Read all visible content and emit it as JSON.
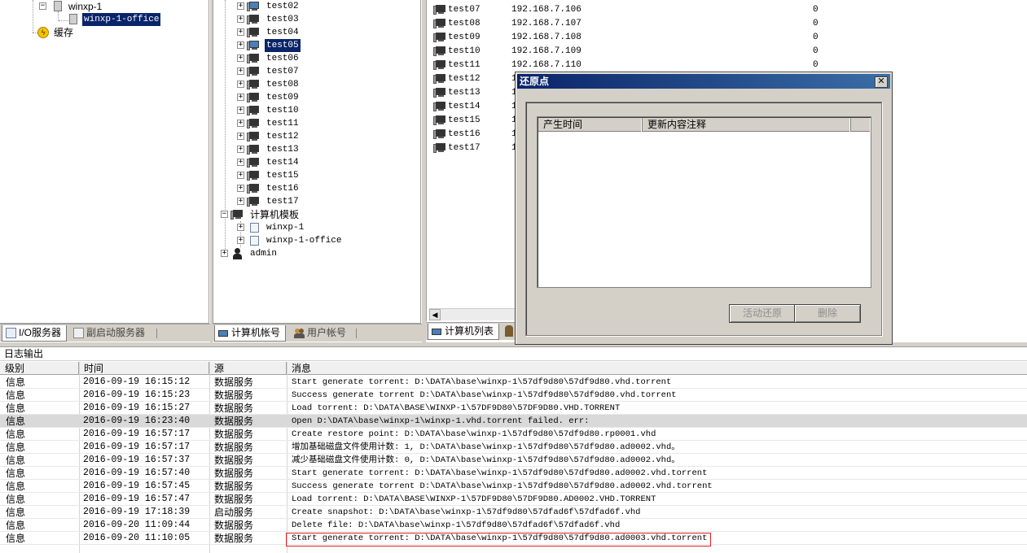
{
  "left_tree": {
    "items": [
      {
        "label": "winxp-1"
      },
      {
        "label": "winxp-1-office"
      },
      {
        "label": "缓存"
      }
    ]
  },
  "left_tabs": [
    "I/O服务器",
    "副启动服务器"
  ],
  "mid_tree": {
    "computers": [
      "test02",
      "test03",
      "test04",
      "test05",
      "test06",
      "test07",
      "test08",
      "test09",
      "test10",
      "test11",
      "test12",
      "test13",
      "test14",
      "test15",
      "test16",
      "test17"
    ],
    "selected": "test05",
    "templates_label": "计算机模板",
    "templates": [
      "winxp-1",
      "winxp-1-office"
    ],
    "user": "admin"
  },
  "mid_tabs": [
    "计算机帐号",
    "用户帐号"
  ],
  "right_list": {
    "rows": [
      {
        "name": "test07",
        "ip": "192.168.7.106",
        "val": "0"
      },
      {
        "name": "test08",
        "ip": "192.168.7.107",
        "val": "0"
      },
      {
        "name": "test09",
        "ip": "192.168.7.108",
        "val": "0"
      },
      {
        "name": "test10",
        "ip": "192.168.7.109",
        "val": "0"
      },
      {
        "name": "test11",
        "ip": "192.168.7.110",
        "val": "0"
      },
      {
        "name": "test12",
        "ip": "1",
        "val": ""
      },
      {
        "name": "test13",
        "ip": "1",
        "val": ""
      },
      {
        "name": "test14",
        "ip": "1",
        "val": ""
      },
      {
        "name": "test15",
        "ip": "1",
        "val": ""
      },
      {
        "name": "test16",
        "ip": "1",
        "val": ""
      },
      {
        "name": "test17",
        "ip": "1",
        "val": ""
      }
    ]
  },
  "right_tabs": [
    "计算机列表"
  ],
  "dialog": {
    "title": "还原点",
    "close": "✕",
    "columns": [
      "产生时间",
      "更新内容注释"
    ],
    "buttons": {
      "restore": "活动还原",
      "delete": "删除"
    }
  },
  "log": {
    "title": "日志输出",
    "columns": [
      "级别",
      "时间",
      "源",
      "消息"
    ],
    "rows": [
      {
        "level": "信息",
        "time": "2016-09-19 16:15:12",
        "source": "数据服务",
        "msg": "Start generate torrent: D:\\DATA\\base\\winxp-1\\57df9d80\\57df9d80.vhd.torrent"
      },
      {
        "level": "信息",
        "time": "2016-09-19 16:15:23",
        "source": "数据服务",
        "msg": "Success generate torrent D:\\DATA\\base\\winxp-1\\57df9d80\\57df9d80.vhd.torrent"
      },
      {
        "level": "信息",
        "time": "2016-09-19 16:15:27",
        "source": "数据服务",
        "msg": "Load torrent: D:\\DATA\\BASE\\WINXP-1\\57DF9D80\\57DF9D80.VHD.TORRENT"
      },
      {
        "level": "信息",
        "time": "2016-09-19 16:23:40",
        "source": "数据服务",
        "msg": "Open D:\\DATA\\base\\winxp-1\\winxp-1.vhd.torrent failed. err:"
      },
      {
        "level": "信息",
        "time": "2016-09-19 16:57:17",
        "source": "数据服务",
        "msg": "Create restore point: D:\\DATA\\base\\winxp-1\\57df9d80\\57df9d80.rp0001.vhd"
      },
      {
        "level": "信息",
        "time": "2016-09-19 16:57:17",
        "source": "数据服务",
        "msg": "增加基础磁盘文件使用计数: 1, D:\\DATA\\base\\winxp-1\\57df9d80\\57df9d80.ad0002.vhd。"
      },
      {
        "level": "信息",
        "time": "2016-09-19 16:57:37",
        "source": "数据服务",
        "msg": "减少基础磁盘文件使用计数: 0, D:\\DATA\\base\\winxp-1\\57df9d80\\57df9d80.ad0002.vhd。"
      },
      {
        "level": "信息",
        "time": "2016-09-19 16:57:40",
        "source": "数据服务",
        "msg": "Start generate torrent: D:\\DATA\\base\\winxp-1\\57df9d80\\57df9d80.ad0002.vhd.torrent"
      },
      {
        "level": "信息",
        "time": "2016-09-19 16:57:45",
        "source": "数据服务",
        "msg": "Success generate torrent D:\\DATA\\base\\winxp-1\\57df9d80\\57df9d80.ad0002.vhd.torrent"
      },
      {
        "level": "信息",
        "time": "2016-09-19 16:57:47",
        "source": "数据服务",
        "msg": "Load torrent: D:\\DATA\\BASE\\WINXP-1\\57DF9D80\\57DF9D80.AD0002.VHD.TORRENT"
      },
      {
        "level": "信息",
        "time": "2016-09-19 17:18:39",
        "source": "启动服务",
        "msg": "Create snapshot: D:\\DATA\\base\\winxp-1\\57df9d80\\57dfad6f\\57dfad6f.vhd"
      },
      {
        "level": "信息",
        "time": "2016-09-20 11:09:44",
        "source": "数据服务",
        "msg": "Delete file: D:\\DATA\\base\\winxp-1\\57df9d80\\57dfad6f\\57dfad6f.vhd"
      },
      {
        "level": "信息",
        "time": "2016-09-20 11:10:05",
        "source": "数据服务",
        "msg": "Start generate torrent: D:\\DATA\\base\\winxp-1\\57df9d80\\57df9d80.ad0003.vhd.torrent"
      }
    ],
    "highlight_color": "#e02020"
  },
  "colors": {
    "selection": "#0a246a",
    "titlebar": "#0a246a",
    "chrome": "#d4d0c8"
  }
}
